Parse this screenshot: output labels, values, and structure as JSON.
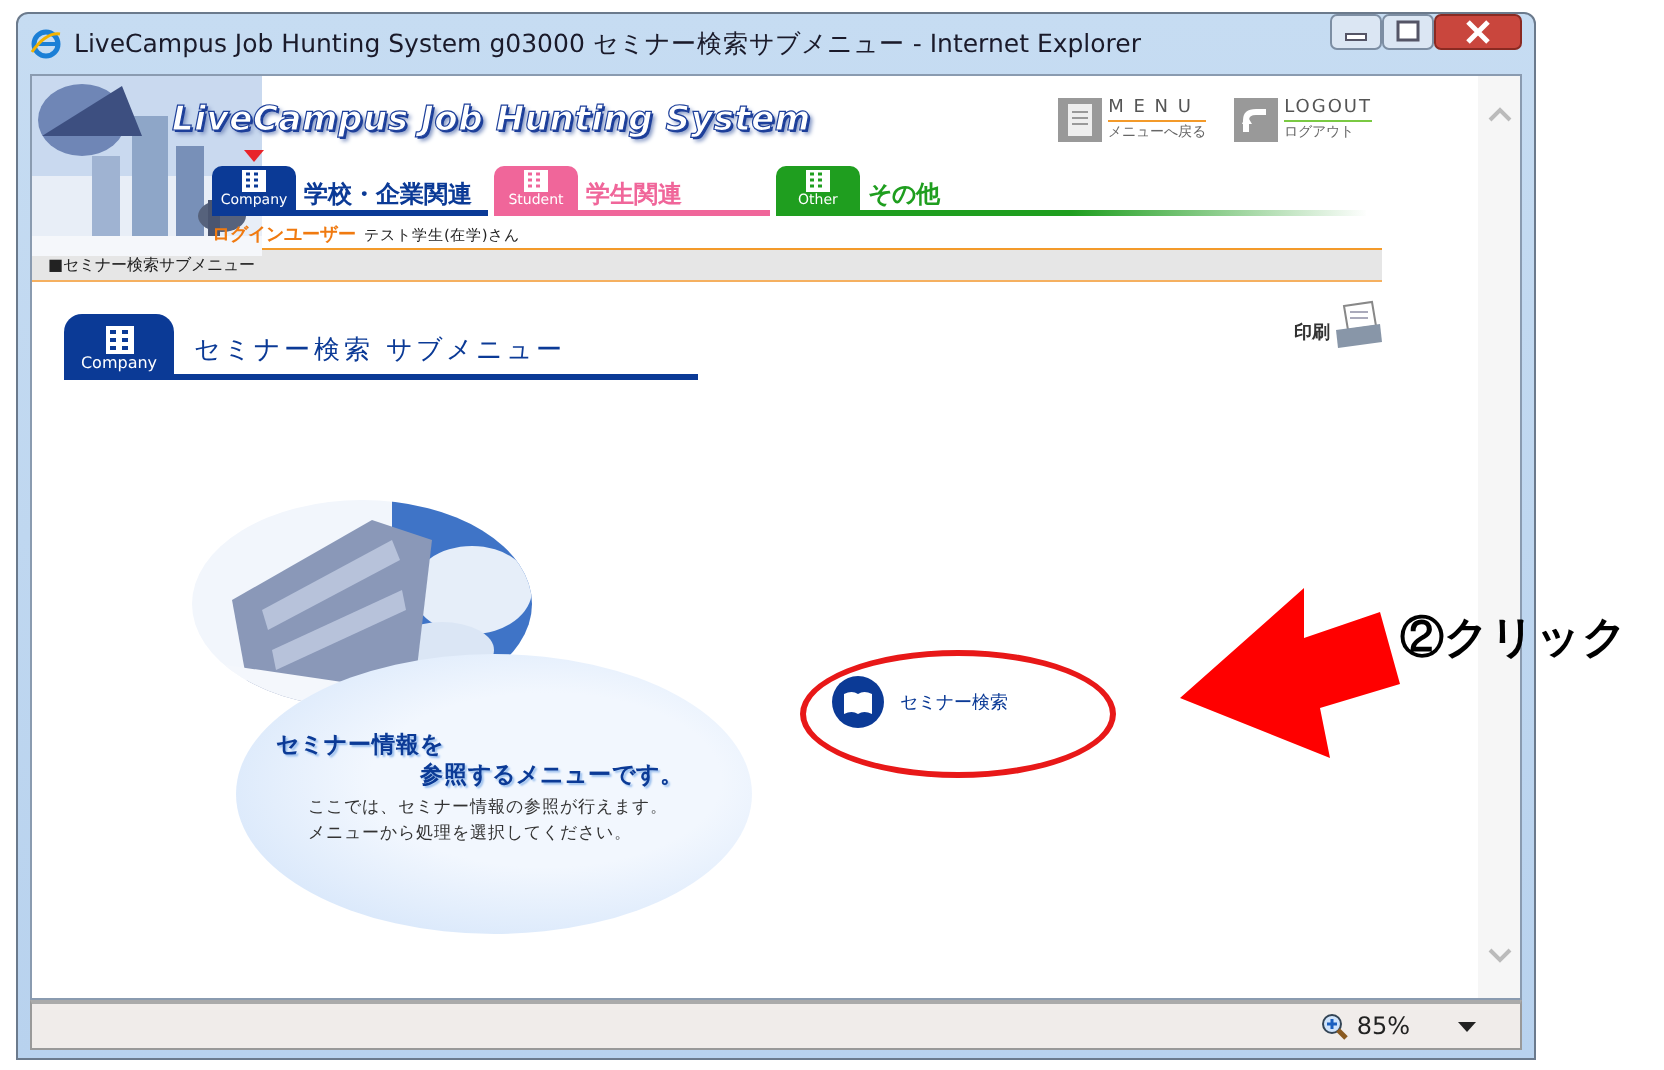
{
  "window": {
    "title": "LiveCampus Job Hunting System g03000 セミナー検索サブメニュー - Internet Explorer"
  },
  "header": {
    "logo_text": "LiveCampus Job Hunting System",
    "menu_link": {
      "label": "M E N U",
      "sublabel": "メニューへ戻る"
    },
    "logout_link": {
      "label": "LOGOUT",
      "sublabel": "ログアウト"
    },
    "tabs": [
      {
        "badge": "Company",
        "label": "学校・企業関連",
        "selected": true,
        "color": "#0b3a96"
      },
      {
        "badge": "Student",
        "label": "学生関連",
        "selected": false,
        "color": "#f0669a"
      },
      {
        "badge": "Other",
        "label": "その他",
        "selected": false,
        "color": "#1f9e1f"
      }
    ],
    "login": {
      "label": "ログインユーザー",
      "user": "テスト学生(在学)さん"
    }
  },
  "breadcrumb": "■セミナー検索サブメニュー",
  "page": {
    "heading_badge": "Company",
    "heading": "セミナー検索 サブメニュー",
    "print_label": "印刷",
    "intro": {
      "title_lines": [
        "セミナー情報を",
        "参照するメニューです。"
      ],
      "body_lines": [
        "ここでは、セミナー情報の参照が行えます。",
        "メニューから処理を選択してください。"
      ]
    },
    "links": [
      {
        "label": "セミナー検索"
      }
    ]
  },
  "status_bar": {
    "zoom": "85%"
  },
  "annotation": {
    "label": "②クリック"
  }
}
